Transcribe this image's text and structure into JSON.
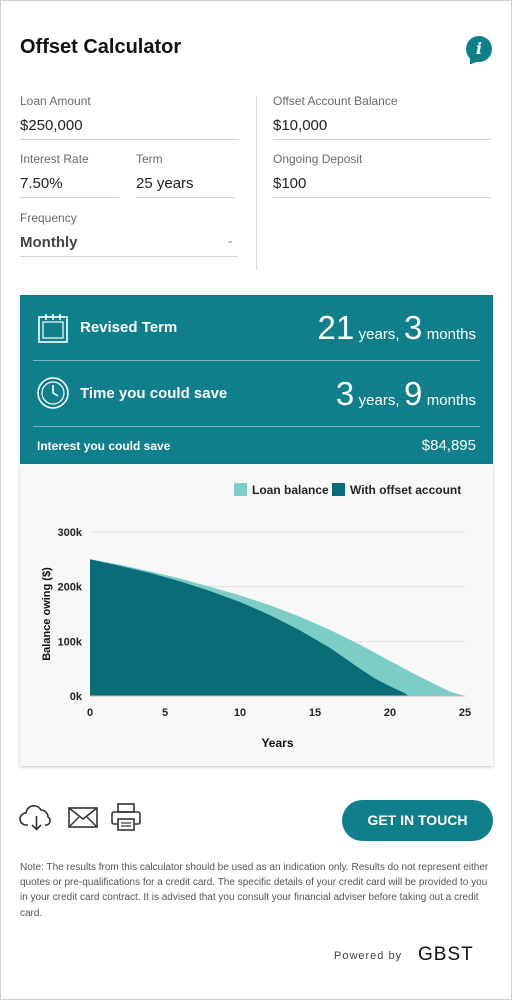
{
  "header": {
    "title": "Offset Calculator",
    "info_icon": "info-icon"
  },
  "inputs": {
    "loan_amount": {
      "label": "Loan Amount",
      "value": "$250,000"
    },
    "interest_rate": {
      "label": "Interest Rate",
      "value": "7.50%"
    },
    "term": {
      "label": "Term",
      "value": "25 years"
    },
    "frequency": {
      "label": "Frequency",
      "value": "Monthly"
    },
    "offset_balance": {
      "label": "Offset Account Balance",
      "value": "$10,000"
    },
    "ongoing_deposit": {
      "label": "Ongoing Deposit",
      "value": "$100"
    }
  },
  "results": {
    "revised_term": {
      "label": "Revised Term",
      "years": "21",
      "years_unit": "years,",
      "months": "3",
      "months_unit": "months"
    },
    "time_saved": {
      "label": "Time you could save",
      "years": "3",
      "years_unit": "years,",
      "months": "9",
      "months_unit": "months"
    },
    "interest_saved": {
      "label": "Interest you could save",
      "value": "$84,895"
    }
  },
  "chart_data": {
    "type": "area",
    "xlabel": "Years",
    "ylabel": "Balance owing ($)",
    "xlim": [
      0,
      25
    ],
    "ylim": [
      0,
      300000
    ],
    "xticks": [
      "0",
      "5",
      "10",
      "15",
      "20",
      "25"
    ],
    "yticks": [
      "0k",
      "100k",
      "200k",
      "300k"
    ],
    "legend_position": "top-right",
    "series": [
      {
        "name": "Loan balance",
        "color": "#7ccdc6",
        "x": [
          0,
          2,
          4,
          6,
          8,
          10,
          12,
          14,
          16,
          18,
          20,
          22,
          24,
          25
        ],
        "values": [
          250000,
          240000,
          228000,
          215000,
          200000,
          184000,
          166000,
          145000,
          121000,
          94000,
          64000,
          35000,
          8000,
          0
        ]
      },
      {
        "name": "With offset account",
        "color": "#0a6c76",
        "x": [
          0,
          2,
          4,
          6,
          8,
          10,
          12,
          14,
          16,
          18,
          19,
          20,
          21,
          21.25
        ],
        "values": [
          250000,
          238000,
          225000,
          210000,
          192000,
          172000,
          148000,
          120000,
          88000,
          50000,
          32000,
          18000,
          5000,
          0
        ]
      }
    ]
  },
  "actions": {
    "download_icon": "cloud-download-icon",
    "email_icon": "envelope-icon",
    "print_icon": "printer-icon",
    "cta_label": "GET IN TOUCH"
  },
  "footer": {
    "note": "Note: The results from this calculator should be used as an indication only. Results do not represent either quotes or pre-qualifications for a credit card. The specific details of your credit card will be provided to you in your credit card contract. It is advised that you consult your financial adviser before taking out a credit card.",
    "powered_by": "Powered by",
    "brand": "GBST"
  }
}
